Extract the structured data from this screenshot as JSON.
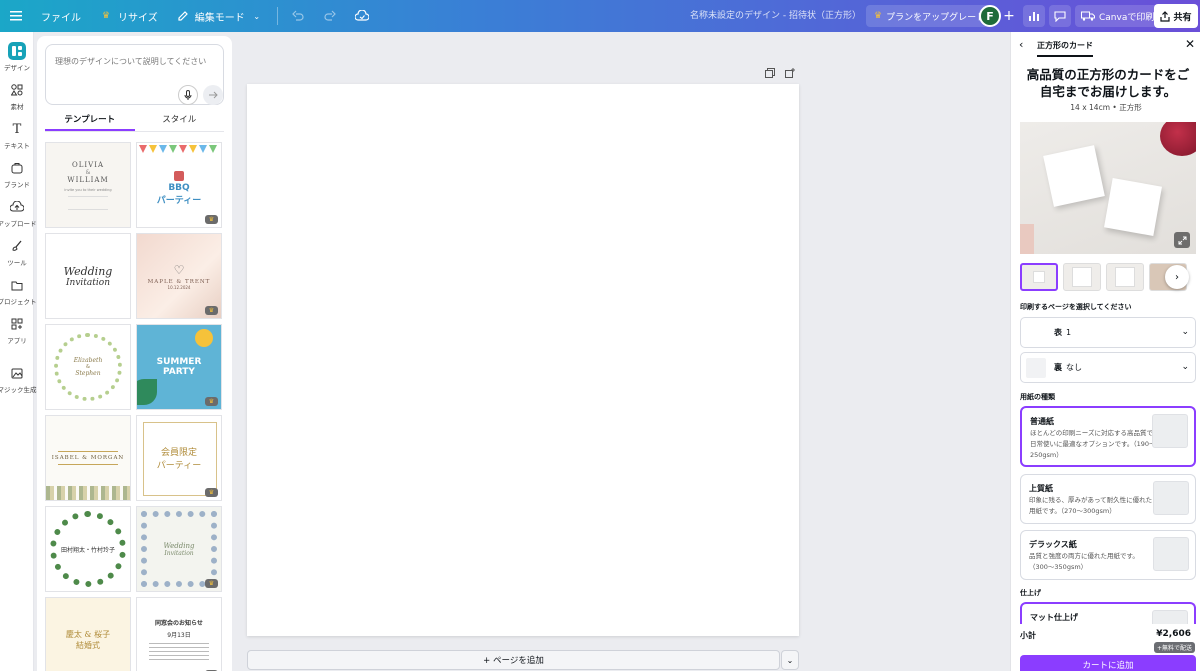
{
  "topbar": {
    "file": "ファイル",
    "resize": "リサイズ",
    "edit_mode": "編集モード",
    "doc_title": "名称未設定のデザイン - 招待状（正方形）",
    "upgrade": "プランをアップグレード",
    "avatar_initial": "F",
    "print": "Canvaで印刷",
    "share": "共有"
  },
  "rail": {
    "items": [
      "デザイン",
      "素材",
      "テキスト",
      "ブランド",
      "アップロード",
      "ツール",
      "プロジェクト",
      "アプリ",
      "マジック生成"
    ]
  },
  "panel": {
    "prompt_placeholder": "理想のデザインについて説明してください",
    "tabs": [
      "テンプレート",
      "スタイル"
    ],
    "templates": [
      {
        "lines": [
          "OLIVIA",
          "&",
          "WILLIAM",
          "invite you to their wedding"
        ]
      },
      {
        "lines": [
          "BBQ",
          "パーティー"
        ]
      },
      {
        "lines": [
          "Wedding",
          "Invitation"
        ]
      },
      {
        "lines": [
          "MAPLE & TRENT",
          "10.12.2024"
        ]
      },
      {
        "lines": [
          "Elizabeth",
          "&",
          "Stephen"
        ]
      },
      {
        "lines": [
          "SUMMER",
          "PARTY"
        ]
      },
      {
        "lines": [
          "ISABEL & MORGAN"
        ]
      },
      {
        "lines": [
          "会員限定",
          "パーティー"
        ]
      },
      {
        "lines": [
          "田村翔太・竹村玲子"
        ]
      },
      {
        "lines": [
          "Wedding",
          "Invitation"
        ]
      },
      {
        "lines": [
          "慶太 & 桜子",
          "結婚式"
        ]
      },
      {
        "lines": [
          "同窓会のお知らせ",
          "9月13日"
        ]
      }
    ]
  },
  "canvas": {
    "add_page": "+ ページを追加"
  },
  "print_panel": {
    "tab": "正方形のカード",
    "title": "高品質の正方形のカードをご自宅までお届けします。",
    "subtitle": "14 x 14cm • 正方形",
    "pages_label": "印刷するページを選択してください",
    "front_label": "表",
    "front_value": "1",
    "back_label": "裏",
    "back_value": "なし",
    "paper_label": "用紙の種類",
    "papers": [
      {
        "name": "普通紙",
        "desc": "ほとんどの印刷ニーズに対応する高品質で日常使いに最適なオプションです。（190〜250gsm）"
      },
      {
        "name": "上質紙",
        "desc": "印象に残る、厚みがあって耐久性に優れた用紙です。（270〜300gsm）"
      },
      {
        "name": "デラックス紙",
        "desc": "品質と強度の両方に優れた用紙です。（300〜350gsm）"
      }
    ],
    "finish_label": "仕上げ",
    "finish_first": "マット仕上げ",
    "subtotal": "小計",
    "price": "¥2,606",
    "shipping": "+無料で配送",
    "cart": "カートに追加"
  },
  "colors": {
    "accent": "#8b3dff",
    "topbar_start": "#1ba7c8",
    "topbar_end": "#6a4fd8"
  }
}
